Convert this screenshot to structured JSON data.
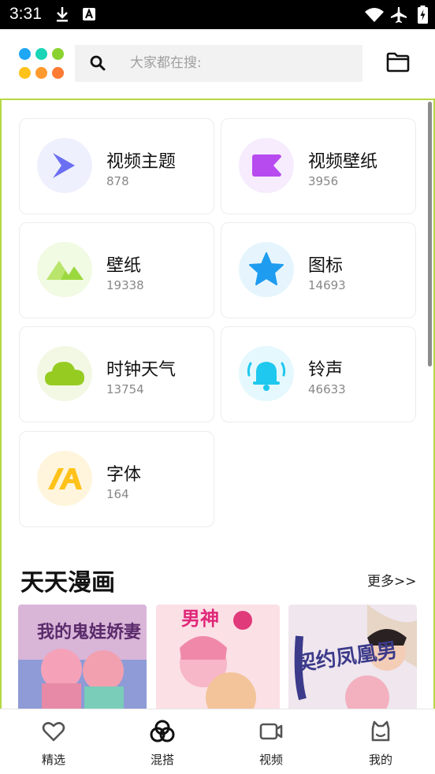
{
  "status_bar": {
    "time": "3:31"
  },
  "header": {
    "search": {
      "placeholder": "大家都在搜:"
    },
    "logo_colors": [
      "#1ea7f5",
      "#19d4b5",
      "#8ad22f",
      "#ffc21a",
      "#ff9a2e",
      "#ff7a32"
    ]
  },
  "categories": [
    {
      "title": "视频主题",
      "count": "878",
      "icon": "play-arrow-icon",
      "bg": "#eef0fd",
      "color": "#6b6ff2"
    },
    {
      "title": "视频壁纸",
      "count": "3956",
      "icon": "video-camera-icon",
      "bg": "#f6ecfd",
      "color": "#b74bf0"
    },
    {
      "title": "壁纸",
      "count": "19338",
      "icon": "mountain-icon",
      "bg": "#f1fae2",
      "color": "#9bd83e"
    },
    {
      "title": "图标",
      "count": "14693",
      "icon": "star-icon",
      "bg": "#e6f5fd",
      "color": "#1e9cf0"
    },
    {
      "title": "时钟天气",
      "count": "13754",
      "icon": "cloud-icon",
      "bg": "#f3f8e4",
      "color": "#96cc22"
    },
    {
      "title": "铃声",
      "count": "46633",
      "icon": "bell-icon",
      "bg": "#e5f8fd",
      "color": "#1ec8ee"
    },
    {
      "title": "字体",
      "count": "164",
      "icon": "font-icon",
      "bg": "#fff5dc",
      "color": "#ffc21a"
    }
  ],
  "comics_section": {
    "title": "天天漫画",
    "more": "更多>>",
    "comics": [
      {
        "title_art": "我的鬼娃娇妻"
      },
      {
        "title_art": "男神"
      },
      {
        "title_art": "契约凤凰男"
      }
    ]
  },
  "bottom_nav": [
    {
      "label": "精选",
      "icon": "heart-icon"
    },
    {
      "label": "混搭",
      "icon": "mix-icon",
      "active": true
    },
    {
      "label": "视频",
      "icon": "video-icon"
    },
    {
      "label": "我的",
      "icon": "profile-icon"
    }
  ]
}
